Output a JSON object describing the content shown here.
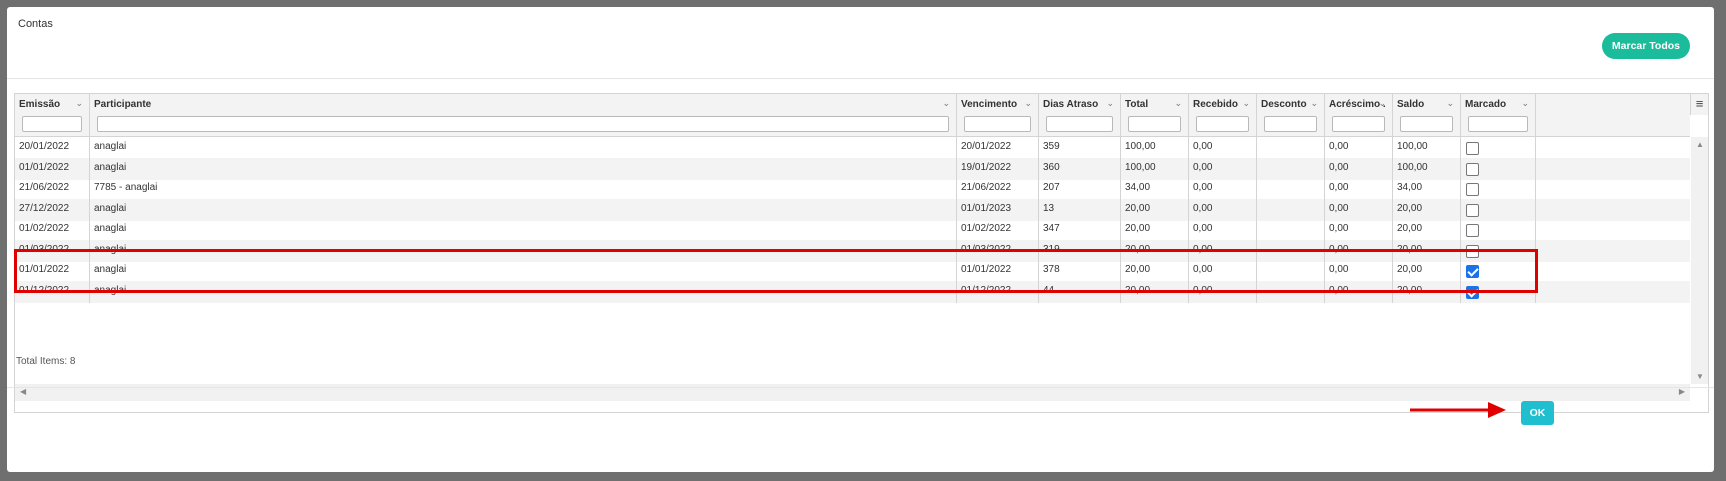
{
  "modal": {
    "title": "Contas",
    "mark_all_label": "Marcar Todos",
    "ok_label": "OK"
  },
  "grid": {
    "columns": [
      {
        "label": "Emissão"
      },
      {
        "label": "Participante"
      },
      {
        "label": "Vencimento"
      },
      {
        "label": "Dias Atraso"
      },
      {
        "label": "Total"
      },
      {
        "label": "Recebido"
      },
      {
        "label": "Desconto"
      },
      {
        "label": "Acréscimo ."
      },
      {
        "label": "Saldo"
      },
      {
        "label": "Marcado"
      }
    ],
    "rows": [
      {
        "emissao": "20/01/2022",
        "participante": "anaglai",
        "vencimento": "20/01/2022",
        "dias_atraso": "359",
        "total": "100,00",
        "recebido": "0,00",
        "desconto": "",
        "acrescimo": "0,00",
        "saldo": "100,00",
        "marcado": false
      },
      {
        "emissao": "01/01/2022",
        "participante": "anaglai",
        "vencimento": "19/01/2022",
        "dias_atraso": "360",
        "total": "100,00",
        "recebido": "0,00",
        "desconto": "",
        "acrescimo": "0,00",
        "saldo": "100,00",
        "marcado": false
      },
      {
        "emissao": "21/06/2022",
        "participante": "7785 - anaglai",
        "vencimento": "21/06/2022",
        "dias_atraso": "207",
        "total": "34,00",
        "recebido": "0,00",
        "desconto": "",
        "acrescimo": "0,00",
        "saldo": "34,00",
        "marcado": false
      },
      {
        "emissao": "27/12/2022",
        "participante": "anaglai",
        "vencimento": "01/01/2023",
        "dias_atraso": "13",
        "total": "20,00",
        "recebido": "0,00",
        "desconto": "",
        "acrescimo": "0,00",
        "saldo": "20,00",
        "marcado": false
      },
      {
        "emissao": "01/02/2022",
        "participante": "anaglai",
        "vencimento": "01/02/2022",
        "dias_atraso": "347",
        "total": "20,00",
        "recebido": "0,00",
        "desconto": "",
        "acrescimo": "0,00",
        "saldo": "20,00",
        "marcado": false
      },
      {
        "emissao": "01/03/2022",
        "participante": "anaglai",
        "vencimento": "01/03/2022",
        "dias_atraso": "319",
        "total": "20,00",
        "recebido": "0,00",
        "desconto": "",
        "acrescimo": "0,00",
        "saldo": "20,00",
        "marcado": false
      },
      {
        "emissao": "01/01/2022",
        "participante": "anaglai",
        "vencimento": "01/01/2022",
        "dias_atraso": "378",
        "total": "20,00",
        "recebido": "0,00",
        "desconto": "",
        "acrescimo": "0,00",
        "saldo": "20,00",
        "marcado": true
      },
      {
        "emissao": "01/12/2022",
        "participante": "anaglai",
        "vencimento": "01/12/2022",
        "dias_atraso": "44",
        "total": "20,00",
        "recebido": "0,00",
        "desconto": "",
        "acrescimo": "0,00",
        "saldo": "20,00",
        "marcado": true
      }
    ],
    "total_items_text": "Total Items: 8"
  },
  "colors": {
    "mark_all_button": "#1abc9c",
    "ok_button": "#1fbfd0",
    "highlight_border": "#e00000",
    "annotation_arrow": "#e00000",
    "checkbox_checked": "#1a73e8"
  },
  "icons": {
    "column_menu": "chevron-down-icon",
    "grid_menu": "hamburger-menu-icon",
    "annotation": "red-arrow-icon"
  }
}
